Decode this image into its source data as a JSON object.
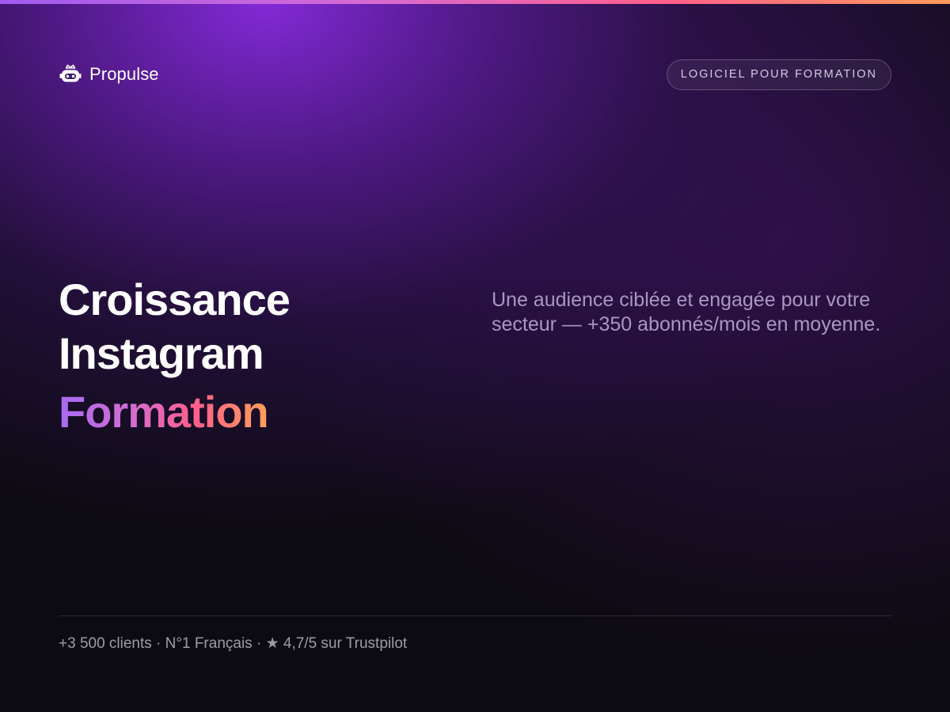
{
  "header": {
    "brand_name": "Propulse",
    "brand_icon": "robot-icon",
    "badge_label": "LOGICIEL POUR FORMATION"
  },
  "hero": {
    "headline_line1": "Croissance",
    "headline_line2": "Instagram",
    "headline_accent": "Formation",
    "description": "Une audience ciblée et engagée pour votre secteur — +350 abonnés/mois en moyenne."
  },
  "footer": {
    "stats": "+3 500 clients · N°1 Français · ★ 4,7/5 sur Trustpilot"
  },
  "colors": {
    "background": "#0d0b12",
    "glow_purple": "#8a2be2",
    "gradient_start": "#a66cf2",
    "gradient_mid": "#ff5f8a",
    "gradient_end": "#ffa05a"
  }
}
